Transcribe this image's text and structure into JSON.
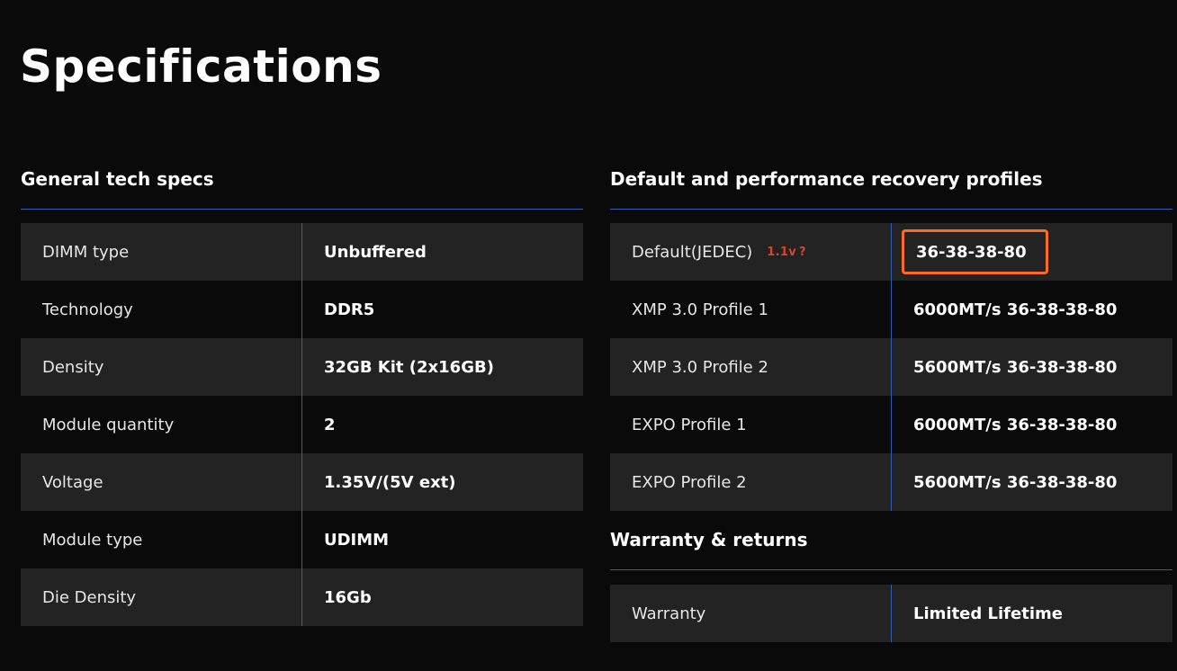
{
  "page": {
    "title": "Specifications"
  },
  "general": {
    "heading": "General tech specs",
    "rows": [
      {
        "label": "DIMM type",
        "value": "Unbuffered"
      },
      {
        "label": "Technology",
        "value": "DDR5"
      },
      {
        "label": "Density",
        "value": "32GB Kit (2x16GB)"
      },
      {
        "label": "Module quantity",
        "value": "2"
      },
      {
        "label": "Voltage",
        "value": "1.35V/(5V ext)"
      },
      {
        "label": "Module type",
        "value": "UDIMM"
      },
      {
        "label": "Die Density",
        "value": "16Gb"
      }
    ]
  },
  "profiles": {
    "heading": "Default and performance recovery profiles",
    "default_voltage_badge": "1.1v",
    "help_glyph": "?",
    "rows": [
      {
        "label": "Default(JEDEC)",
        "value": "36-38-38-80"
      },
      {
        "label": "XMP 3.0 Profile 1",
        "value": "6000MT/s 36-38-38-80"
      },
      {
        "label": "XMP 3.0 Profile 2",
        "value": "5600MT/s 36-38-38-80"
      },
      {
        "label": "EXPO Profile 1",
        "value": "6000MT/s 36-38-38-80"
      },
      {
        "label": "EXPO Profile 2",
        "value": "5600MT/s 36-38-38-80"
      }
    ]
  },
  "warranty": {
    "heading": "Warranty & returns",
    "rows": [
      {
        "label": "Warranty",
        "value": "Limited Lifetime"
      }
    ]
  },
  "colors": {
    "background": "#0b0a0b",
    "row_shade": "#242324",
    "divider_blue": "#2f5fb0",
    "highlight_orange": "#ff6a21",
    "badge_red": "#d9452b"
  }
}
